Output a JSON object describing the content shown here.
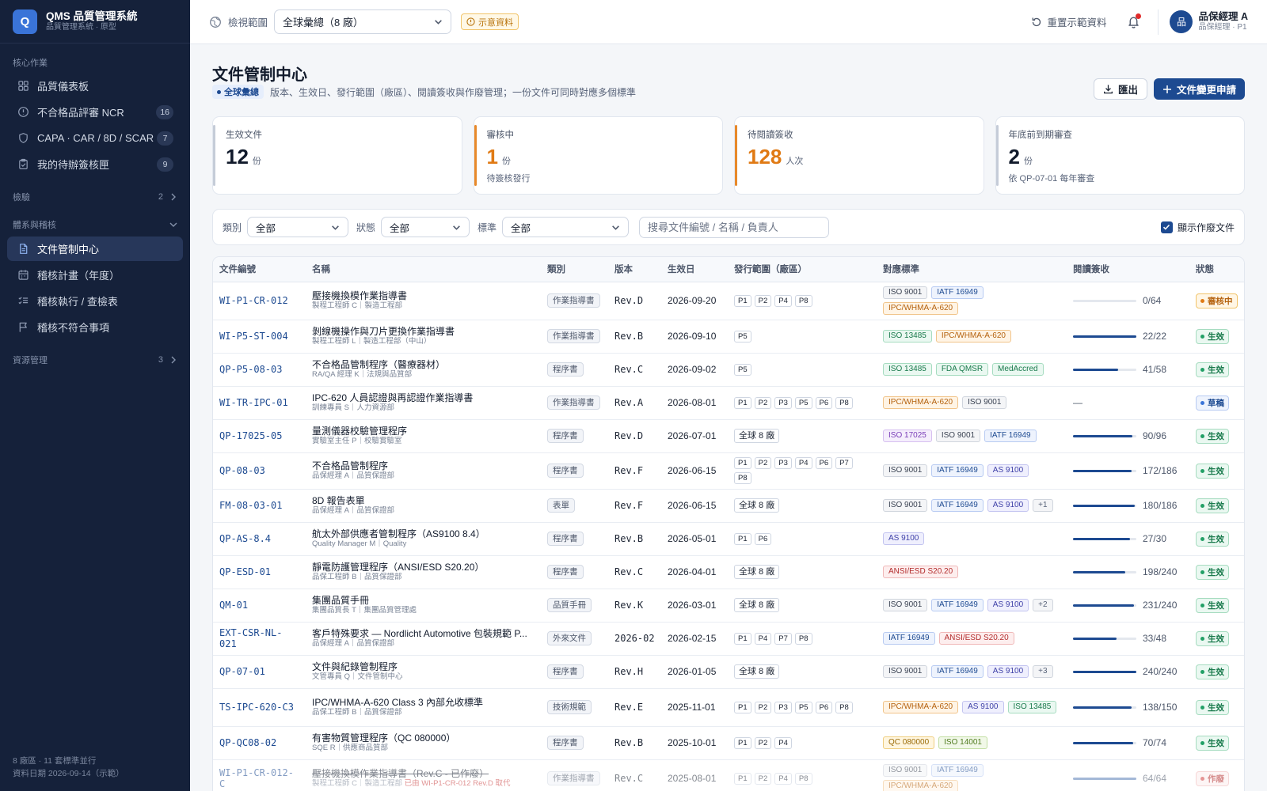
{
  "app": {
    "logo": "Q",
    "title": "QMS 品質管理系統",
    "subtitle": "品質管理系統 · 原型"
  },
  "sidebar": {
    "core_label": "核心作業",
    "core_items": [
      {
        "name": "dashboard",
        "icon": "grid-icon",
        "label": "品質儀表板",
        "badge": ""
      },
      {
        "name": "ncr",
        "icon": "alert-circle-icon",
        "label": "不合格品評審 NCR",
        "badge": "16"
      },
      {
        "name": "capa",
        "icon": "shield-icon",
        "label": "CAPA · CAR / 8D / SCAR",
        "badge": "7"
      },
      {
        "name": "approvals",
        "icon": "clipboard-check-icon",
        "label": "我的待辦簽核匣",
        "badge": "9"
      }
    ],
    "inspection": {
      "label": "檢驗",
      "count": "2"
    },
    "system_label": "體系與稽核",
    "system_items": [
      {
        "name": "doc-center",
        "icon": "document-icon",
        "label": "文件管制中心",
        "active": true
      },
      {
        "name": "audit-plan",
        "icon": "calendar-icon",
        "label": "稽核計畫（年度）"
      },
      {
        "name": "audit-exec",
        "icon": "checklist-icon",
        "label": "稽核執行 / 查檢表"
      },
      {
        "name": "audit-nc",
        "icon": "flag-icon",
        "label": "稽核不符合事項"
      }
    ],
    "resources": {
      "label": "資源管理",
      "count": "3"
    },
    "footer_line1": "8 廠區 · 11 套標準並行",
    "footer_line2": "資料日期 2026-09-14（示範）"
  },
  "topbar": {
    "scope_label": "檢視範圍",
    "scope_value": "全球彙總（8 廠）",
    "demo_badge": "示意資料",
    "reset_label": "重置示範資料",
    "user_avatar": "品",
    "user_name": "品保經理 A",
    "user_role": "品保經理 · P1"
  },
  "page": {
    "title": "文件管制中心",
    "scope_chip": "全球彙總",
    "description": "版本、生效日、發行範圍（廠區）、閱讀簽收與作廢管理；一份文件可同時對應多個標準",
    "export_label": "匯出",
    "new_label": "文件變更申請"
  },
  "kpis": [
    {
      "label": "生效文件",
      "value": "12",
      "unit": "份",
      "note": "",
      "color": "#c5ccd8",
      "value_color": "#111a2b"
    },
    {
      "label": "審核中",
      "value": "1",
      "unit": "份",
      "note": "待簽核發行",
      "color": "#e8892a",
      "value_color": "#e07a14"
    },
    {
      "label": "待閱讀簽收",
      "value": "128",
      "unit": "人次",
      "note": "",
      "color": "#e8892a",
      "value_color": "#e07a14"
    },
    {
      "label": "年底前到期審查",
      "value": "2",
      "unit": "份",
      "note": "依 QP-07-01 每年審查",
      "color": "#c5ccd8",
      "value_color": "#111a2b"
    }
  ],
  "filters": {
    "category_label": "類別",
    "category_value": "全部",
    "status_label": "狀態",
    "status_value": "全部",
    "standard_label": "標準",
    "standard_value": "全部",
    "search_placeholder": "搜尋文件編號 / 名稱 / 負責人",
    "show_obsolete_label": "顯示作廢文件"
  },
  "table": {
    "headers": [
      "文件編號",
      "名稱",
      "類別",
      "版本",
      "生效日",
      "發行範圍（廠區）",
      "對應標準",
      "閱讀簽收",
      "狀態"
    ],
    "rows": [
      {
        "code": "WI-P1-CR-012",
        "name": "壓接機換模作業指導書",
        "owner": "製程工程師 C｜製造工程部",
        "type": "作業指導書",
        "ver": "Rev.D",
        "date": "2026-09-20",
        "plants": [
          "P1",
          "P2",
          "P4",
          "P8"
        ],
        "stds": [
          "ISO 9001",
          "IATF 16949",
          "IPC/WHMA-A-620"
        ],
        "read": "0/64",
        "pct": 0,
        "status": "審核中",
        "st": "review",
        "h": 48
      },
      {
        "code": "WI-P5-ST-004",
        "name": "剝線機操作與刀片更換作業指導書",
        "owner": "製程工程師 L｜製造工程部（中山）",
        "type": "作業指導書",
        "ver": "Rev.B",
        "date": "2026-09-10",
        "plants": [
          "P5"
        ],
        "stds": [
          "ISO 13485",
          "IPC/WHMA-A-620"
        ],
        "read": "22/22",
        "pct": 1,
        "status": "生效",
        "st": "active",
        "h": 42
      },
      {
        "code": "QP-P5-08-03",
        "name": "不合格品管制程序（醫療器材）",
        "owner": "RA/QA 經理 K｜法規與品質部",
        "type": "程序書",
        "ver": "Rev.C",
        "date": "2026-09-02",
        "plants": [
          "P5"
        ],
        "stds": [
          "ISO 13485",
          "FDA QMSR",
          "MedAccred"
        ],
        "read": "41/58",
        "pct": 0.71,
        "status": "生效",
        "st": "active",
        "h": 42
      },
      {
        "code": "WI-TR-IPC-01",
        "name": "IPC-620 人員認證與再認證作業指導書",
        "owner": "訓練專員 S｜人力資源部",
        "type": "作業指導書",
        "ver": "Rev.A",
        "date": "2026-08-01",
        "plants": [
          "P1",
          "P2",
          "P3",
          "P5",
          "P6",
          "P8"
        ],
        "stds": [
          "IPC/WHMA-A-620",
          "ISO 9001"
        ],
        "read": "—",
        "pct": null,
        "status": "草稿",
        "st": "draft",
        "h": 42
      },
      {
        "code": "QP-17025-05",
        "name": "量測儀器校驗管理程序",
        "owner": "實驗室主任 P｜校驗實驗室",
        "type": "程序書",
        "ver": "Rev.D",
        "date": "2026-07-01",
        "plants": [
          "全球 8 廠"
        ],
        "stds": [
          "ISO 17025",
          "ISO 9001",
          "IATF 16949"
        ],
        "read": "90/96",
        "pct": 0.94,
        "status": "生效",
        "st": "active",
        "h": 42
      },
      {
        "code": "QP-08-03",
        "name": "不合格品管制程序",
        "owner": "品保經理 A｜品質保證部",
        "type": "程序書",
        "ver": "Rev.F",
        "date": "2026-06-15",
        "plants": [
          "P1",
          "P2",
          "P3",
          "P4",
          "P6",
          "P7",
          "P8"
        ],
        "stds": [
          "ISO 9001",
          "IATF 16949",
          "AS 9100"
        ],
        "read": "172/186",
        "pct": 0.92,
        "status": "生效",
        "st": "active",
        "h": 46
      },
      {
        "code": "FM-08-03-01",
        "name": "8D 報告表單",
        "owner": "品保經理 A｜品質保證部",
        "type": "表單",
        "ver": "Rev.F",
        "date": "2026-06-15",
        "plants": [
          "全球 8 廠"
        ],
        "stds": [
          "ISO 9001",
          "IATF 16949",
          "AS 9100",
          "+1"
        ],
        "read": "180/186",
        "pct": 0.97,
        "status": "生效",
        "st": "active",
        "h": 42
      },
      {
        "code": "QP-AS-8.4",
        "name": "航太外部供應者管制程序（AS9100 8.4）",
        "owner": "Quality Manager M｜Quality",
        "type": "程序書",
        "ver": "Rev.B",
        "date": "2026-05-01",
        "plants": [
          "P1",
          "P6"
        ],
        "stds": [
          "AS 9100"
        ],
        "read": "27/30",
        "pct": 0.9,
        "status": "生效",
        "st": "active",
        "h": 42
      },
      {
        "code": "QP-ESD-01",
        "name": "靜電防護管理程序（ANSI/ESD S20.20）",
        "owner": "品保工程師 B｜品質保證部",
        "type": "程序書",
        "ver": "Rev.C",
        "date": "2026-04-01",
        "plants": [
          "全球 8 廠"
        ],
        "stds": [
          "ANSI/ESD S20.20"
        ],
        "read": "198/240",
        "pct": 0.83,
        "status": "生效",
        "st": "active",
        "h": 42
      },
      {
        "code": "QM-01",
        "name": "集團品質手冊",
        "owner": "集團品質長 T｜集團品質管理處",
        "type": "品質手冊",
        "ver": "Rev.K",
        "date": "2026-03-01",
        "plants": [
          "全球 8 廠"
        ],
        "stds": [
          "ISO 9001",
          "IATF 16949",
          "AS 9100",
          "+2"
        ],
        "read": "231/240",
        "pct": 0.96,
        "status": "生效",
        "st": "active",
        "h": 42
      },
      {
        "code": "EXT-CSR-NL-021",
        "name": "客戶特殊要求 — Nordlicht Automotive 包裝規範 P...",
        "owner": "品保經理 A｜品質保證部",
        "type": "外來文件",
        "ver": "2026-02",
        "date": "2026-02-15",
        "plants": [
          "P1",
          "P4",
          "P7",
          "P8"
        ],
        "stds": [
          "IATF 16949",
          "ANSI/ESD S20.20"
        ],
        "read": "33/48",
        "pct": 0.69,
        "status": "生效",
        "st": "active",
        "h": 42
      },
      {
        "code": "QP-07-01",
        "name": "文件與紀錄管制程序",
        "owner": "文管專員 Q｜文件管制中心",
        "type": "程序書",
        "ver": "Rev.H",
        "date": "2026-01-05",
        "plants": [
          "全球 8 廠"
        ],
        "stds": [
          "ISO 9001",
          "IATF 16949",
          "AS 9100",
          "+3"
        ],
        "read": "240/240",
        "pct": 1,
        "status": "生效",
        "st": "active",
        "h": 42
      },
      {
        "code": "TS-IPC-620-C3",
        "name": "IPC/WHMA-A-620 Class 3 內部允收標準",
        "owner": "品保工程師 B｜品質保證部",
        "type": "技術規範",
        "ver": "Rev.E",
        "date": "2025-11-01",
        "plants": [
          "P1",
          "P2",
          "P3",
          "P5",
          "P6",
          "P8"
        ],
        "stds": [
          "IPC/WHMA-A-620",
          "AS 9100",
          "ISO 13485"
        ],
        "read": "138/150",
        "pct": 0.92,
        "status": "生效",
        "st": "active",
        "h": 48
      },
      {
        "code": "QP-QC08-02",
        "name": "有害物質管理程序（QC 080000）",
        "owner": "SQE R｜供應商品質部",
        "type": "程序書",
        "ver": "Rev.B",
        "date": "2025-10-01",
        "plants": [
          "P1",
          "P2",
          "P4"
        ],
        "stds": [
          "QC 080000",
          "ISO 14001"
        ],
        "read": "70/74",
        "pct": 0.95,
        "status": "生效",
        "st": "active",
        "h": 42
      },
      {
        "code": "WI-P1-CR-012-C",
        "name": "壓接機換模作業指導書（Rev.C - 已作廢）",
        "owner": "製程工程師 C｜製造工程部",
        "owner_note": "已由 WI-P1-CR-012 Rev.D 取代",
        "type": "作業指導書",
        "ver": "Rev.C",
        "date": "2025-08-01",
        "plants": [
          "P1",
          "P2",
          "P4",
          "P8"
        ],
        "stds": [
          "ISO 9001",
          "IATF 16949",
          "IPC/WHMA-A-620"
        ],
        "read": "64/64",
        "pct": 1,
        "status": "作廢",
        "st": "obsolete",
        "h": 48
      }
    ]
  },
  "std_colors": {
    "ISO 9001": {
      "bg": "#f4f5f7",
      "border": "#d0d5dd",
      "fg": "#3a4252"
    },
    "IATF 16949": {
      "bg": "#eef3fd",
      "border": "#b8cbf2",
      "fg": "#1d4a91"
    },
    "IPC/WHMA-A-620": {
      "bg": "#fff4e5",
      "border": "#f1c48a",
      "fg": "#b5620e"
    },
    "ISO 13485": {
      "bg": "#eaf8f1",
      "border": "#a6dcc0",
      "fg": "#197a4c"
    },
    "FDA QMSR": {
      "bg": "#eaf8f1",
      "border": "#a6dcc0",
      "fg": "#197a4c"
    },
    "MedAccred": {
      "bg": "#eaf8f1",
      "border": "#a6dcc0",
      "fg": "#197a4c"
    },
    "ISO 17025": {
      "bg": "#f5eefc",
      "border": "#d6bff0",
      "fg": "#7a3db8"
    },
    "AS 9100": {
      "bg": "#efeffd",
      "border": "#c3c4f0",
      "fg": "#3f41a8"
    },
    "ANSI/ESD S20.20": {
      "bg": "#fdeeee",
      "border": "#f0b8b8",
      "fg": "#b32d2d"
    },
    "QC 080000": {
      "bg": "#fff6e0",
      "border": "#efce80",
      "fg": "#9a6a06"
    },
    "ISO 14001": {
      "bg": "#f1f8e8",
      "border": "#c2dea3",
      "fg": "#4f7a1e"
    },
    "+1": {
      "bg": "#f4f5f7",
      "border": "#d0d5dd",
      "fg": "#59647a"
    },
    "+2": {
      "bg": "#f4f5f7",
      "border": "#d0d5dd",
      "fg": "#59647a"
    },
    "+3": {
      "bg": "#f4f5f7",
      "border": "#d0d5dd",
      "fg": "#59647a"
    }
  },
  "status_colors": {
    "review": {
      "bg": "#fff6e5",
      "border": "#f1c46a",
      "fg": "#b5620e",
      "dot": "#e07a14"
    },
    "active": {
      "bg": "#eaf8f1",
      "border": "#a6dcc0",
      "fg": "#197a4c",
      "dot": "#22a066"
    },
    "draft": {
      "bg": "#eef3fd",
      "border": "#b8cbf2",
      "fg": "#1d4a91",
      "dot": "#3a74d8"
    },
    "obsolete": {
      "bg": "#fdeeee",
      "border": "#f0b8b8",
      "fg": "#b32d2d",
      "dot": "#d04040"
    }
  }
}
